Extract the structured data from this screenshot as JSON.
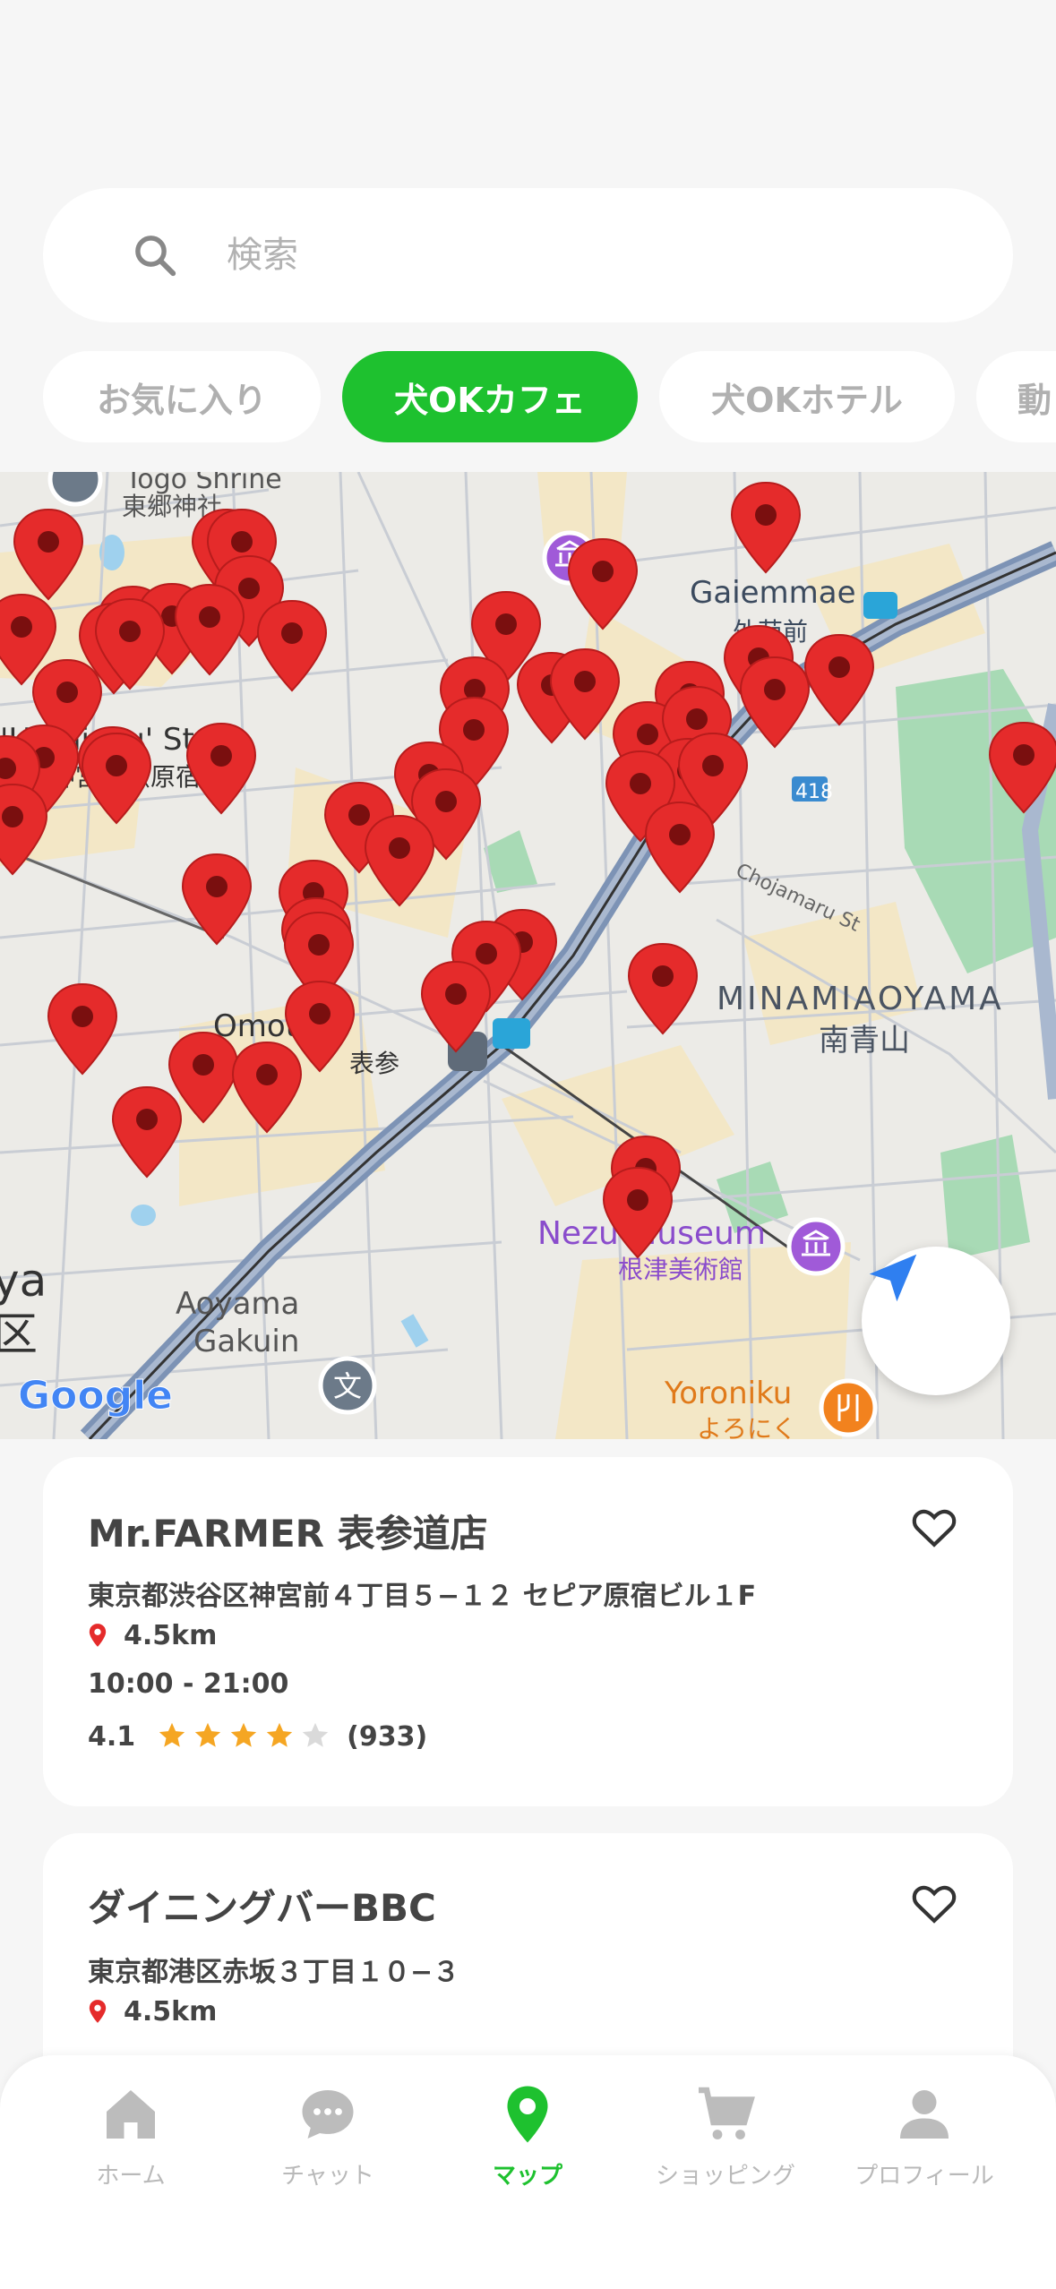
{
  "search": {
    "placeholder": "検索",
    "icon": "search-icon"
  },
  "chips": [
    {
      "label": "お気に入り",
      "active": false
    },
    {
      "label": "犬OKカフェ",
      "active": true
    },
    {
      "label": "犬OKホテル",
      "active": false
    },
    {
      "label": "動",
      "active": false
    }
  ],
  "map": {
    "labels": {
      "gaiemmae_en": "Gaiemmae",
      "gaiemmae_ja": "外苑前",
      "harajuku_en": "'Harajuku' Sta.",
      "harajuku_ja": "明治神宮前〈原宿〉",
      "togo": "Togo Shrine",
      "togo_ja": "東郷神社",
      "omote": "Omote-S",
      "omote_ja": "表参",
      "minamiaoyama_en": "MINAMIAOYAMA",
      "minamiaoyama_ja": "南青山",
      "chojamaru": "Chojamaru St",
      "museum_en": "Nezu Museum",
      "museum_ja": "根津美術館",
      "aoyama": "Aoyama",
      "gakuin": "Gakuin",
      "yoroniku_en": "Yoroniku",
      "yoroniku_ja": "よろにく",
      "google": "Google",
      "route": "418",
      "left_a": "ya",
      "left_b": "区"
    },
    "accent_pin": "#e52b2b",
    "road_highway": "#7d93b5"
  },
  "results": [
    {
      "name": "Mr.FARMER 表参道店",
      "address": "東京都渋谷区神宮前４丁目５−１２ セピア原宿ビル１F",
      "distance": "4.5km",
      "hours": "10:00 - 21:00",
      "rating": "4.1",
      "stars": 4,
      "reviews": "(933)"
    },
    {
      "name": "ダイニングバーBBC",
      "address": "東京都港区赤坂３丁目１０−３",
      "distance": "4.5km"
    }
  ],
  "tabs": [
    {
      "label": "ホーム",
      "icon": "home-icon"
    },
    {
      "label": "チャット",
      "icon": "chat-icon"
    },
    {
      "label": "マップ",
      "icon": "map-pin-icon"
    },
    {
      "label": "ショッピング",
      "icon": "cart-icon"
    },
    {
      "label": "プロフィール",
      "icon": "profile-icon"
    }
  ],
  "colors": {
    "accent": "#1ec12f",
    "pin": "#e52b2b",
    "locate": "#2f7ff0",
    "star": "#f5a623"
  }
}
